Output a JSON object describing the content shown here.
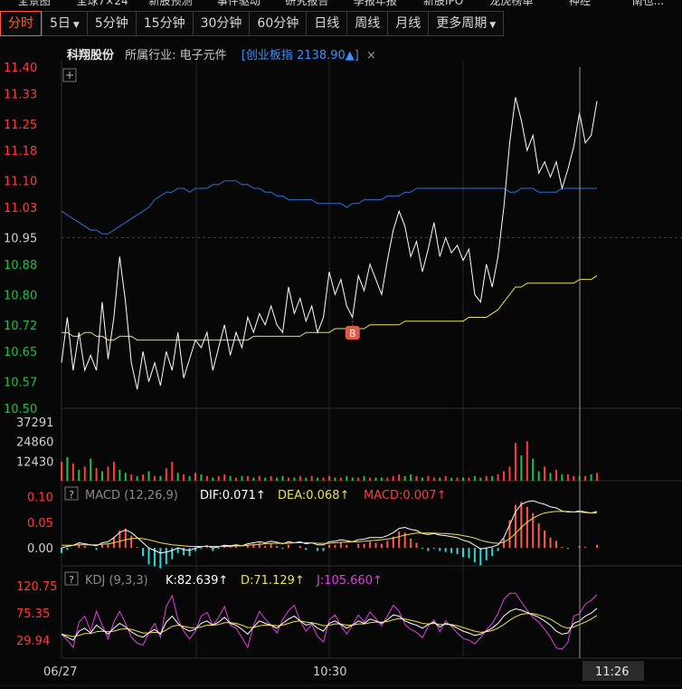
{
  "top_nav": [
    "全景图",
    "全球7×24",
    "新股预测",
    "事件驱动",
    "研究报告",
    "季报年报",
    "新股IPO",
    "龙虎榜单",
    "神经",
    "南也..."
  ],
  "tabs": [
    {
      "label": "分时",
      "active": true
    },
    {
      "label": "5日",
      "dropdown": true
    },
    {
      "label": "5分钟"
    },
    {
      "label": "15分钟"
    },
    {
      "label": "30分钟"
    },
    {
      "label": "60分钟"
    },
    {
      "label": "日线"
    },
    {
      "label": "周线"
    },
    {
      "label": "月线"
    },
    {
      "label": "更多周期",
      "dropdown": true
    }
  ],
  "info": {
    "stock_name": "科翔股份",
    "industry": "所属行业: 电子元件",
    "index": "[创业板指 2138.90▲]",
    "close": "×"
  },
  "price_axis": [
    "11.40",
    "11.33",
    "11.25",
    "11.18",
    "11.10",
    "11.03",
    "10.95",
    "10.88",
    "10.80",
    "10.72",
    "10.65",
    "10.57",
    "10.50"
  ],
  "volume_axis": [
    "37291",
    "24860",
    "12430"
  ],
  "macd": {
    "title": "MACD",
    "params": "(12,26,9)",
    "dif": "DIF:0.071↑",
    "dea": "DEA:0.068↑",
    "macd": "MACD:0.007↑",
    "axis": [
      "0.10",
      "0.05",
      "0.00"
    ]
  },
  "kdj": {
    "title": "KDJ",
    "params": "(9,3,3)",
    "k": "K:82.639↑",
    "d": "D:71.129↑",
    "j": "J:105.660↑",
    "axis": [
      "120.75",
      "75.35",
      "29.94"
    ]
  },
  "time_axis": {
    "start": "06/27",
    "mid": "10:30",
    "cursor": "11:26"
  },
  "marker": {
    "label": "B"
  },
  "colors": {
    "up": "#ff3b3b",
    "down": "#1fbf4a",
    "price": "#ffffff",
    "avg": "#e8e05a",
    "index": "#2f6fd8",
    "macd_pos": "#ff5a4a",
    "macd_neg": "#30d8d8",
    "k": "#ffffff",
    "d": "#f0e040",
    "j": "#e040e0"
  },
  "chart_data": [
    {
      "type": "line",
      "title": "",
      "ylim": [
        10.5,
        11.4
      ],
      "series": [
        {
          "values": [
            10.62,
            10.74,
            10.6,
            10.7,
            10.6,
            10.64,
            10.6,
            10.78,
            10.63,
            10.74,
            10.9,
            10.78,
            10.62,
            10.55,
            10.65,
            10.57,
            10.62,
            10.56,
            10.65,
            10.6,
            10.7,
            10.58,
            10.63,
            10.68,
            10.66,
            10.7,
            10.6,
            10.66,
            10.72,
            10.64,
            10.7,
            10.66,
            10.74,
            10.7,
            10.75,
            10.72,
            10.77,
            10.72,
            10.7,
            10.82,
            10.75,
            10.79,
            10.73,
            10.77,
            10.7,
            10.74,
            10.86,
            10.8,
            10.84,
            10.77,
            10.74,
            10.85,
            10.81,
            10.88,
            10.84,
            10.8,
            10.89,
            10.97,
            11.02,
            10.98,
            10.9,
            10.94,
            10.86,
            10.92,
            10.99,
            10.9,
            10.95,
            10.91,
            10.93,
            10.89,
            10.92,
            10.8,
            10.78,
            10.88,
            10.82,
            10.9,
            11.03,
            11.2,
            11.32,
            11.26,
            11.18,
            11.22,
            11.12,
            11.15,
            11.11,
            11.15,
            11.08,
            11.13,
            11.19,
            11.28,
            11.2,
            11.22,
            11.31
          ]
        },
        {
          "values": [
            10.7,
            10.7,
            10.69,
            10.69,
            10.7,
            10.7,
            10.69,
            10.69,
            10.68,
            10.68,
            10.69,
            10.69,
            10.69,
            10.68,
            10.68,
            10.68,
            10.68,
            10.68,
            10.68,
            10.68,
            10.68,
            10.68,
            10.68,
            10.68,
            10.68,
            10.68,
            10.68,
            10.68,
            10.68,
            10.68,
            10.68,
            10.68,
            10.68,
            10.69,
            10.69,
            10.69,
            10.69,
            10.69,
            10.69,
            10.69,
            10.69,
            10.69,
            10.7,
            10.7,
            10.7,
            10.7,
            10.7,
            10.71,
            10.71,
            10.71,
            10.71,
            10.71,
            10.71,
            10.72,
            10.72,
            10.72,
            10.72,
            10.72,
            10.72,
            10.73,
            10.73,
            10.73,
            10.73,
            10.73,
            10.73,
            10.73,
            10.73,
            10.73,
            10.73,
            10.73,
            10.74,
            10.74,
            10.74,
            10.74,
            10.75,
            10.76,
            10.78,
            10.8,
            10.82,
            10.82,
            10.83,
            10.83,
            10.83,
            10.83,
            10.83,
            10.83,
            10.83,
            10.83,
            10.83,
            10.84,
            10.84,
            10.84,
            10.85
          ]
        },
        {
          "values": [
            11.02,
            11.01,
            11.0,
            10.99,
            10.98,
            10.97,
            10.97,
            10.96,
            10.96,
            10.97,
            10.98,
            10.99,
            11.0,
            11.01,
            11.02,
            11.03,
            11.05,
            11.06,
            11.07,
            11.07,
            11.08,
            11.08,
            11.07,
            11.08,
            11.08,
            11.08,
            11.09,
            11.09,
            11.1,
            11.1,
            11.1,
            11.09,
            11.09,
            11.08,
            11.08,
            11.07,
            11.07,
            11.06,
            11.06,
            11.05,
            11.05,
            11.05,
            11.05,
            11.05,
            11.04,
            11.04,
            11.04,
            11.04,
            11.04,
            11.03,
            11.04,
            11.04,
            11.05,
            11.05,
            11.05,
            11.05,
            11.06,
            11.06,
            11.06,
            11.07,
            11.07,
            11.08,
            11.08,
            11.08,
            11.08,
            11.08,
            11.08,
            11.08,
            11.08,
            11.08,
            11.08,
            11.08,
            11.08,
            11.08,
            11.08,
            11.08,
            11.08,
            11.07,
            11.07,
            11.08,
            11.08,
            11.08,
            11.07,
            11.07,
            11.07,
            11.07,
            11.08,
            11.08,
            11.08,
            11.08,
            11.08,
            11.08,
            11.08
          ]
        }
      ]
    },
    {
      "type": "bar",
      "title": "",
      "ylim": [
        0,
        37291
      ],
      "values": [
        12000,
        15000,
        11000,
        7000,
        9000,
        14000,
        8000,
        6000,
        9000,
        12000,
        7000,
        5000,
        4000,
        3000,
        4000,
        6000,
        3000,
        3000,
        8000,
        12000,
        5000,
        4000,
        3000,
        5000,
        4000,
        3000,
        2000,
        3000,
        4000,
        3000,
        2000,
        3000,
        3000,
        2000,
        3000,
        2000,
        3000,
        2000,
        3000,
        2000,
        2000,
        3000,
        2000,
        3000,
        2000,
        2000,
        3000,
        2000,
        2000,
        3000,
        2000,
        2000,
        3000,
        2000,
        2000,
        2000,
        2000,
        3000,
        4000,
        3000,
        4000,
        3000,
        2000,
        3000,
        2000,
        2000,
        3000,
        2000,
        2000,
        2000,
        2000,
        3000,
        2000,
        3000,
        3000,
        4000,
        6000,
        9000,
        24000,
        16000,
        25000,
        14000,
        6000,
        9000,
        5000,
        7000,
        4000,
        4000,
        3000,
        3000,
        3000,
        4000,
        5000
      ],
      "up": [
        1,
        0,
        1,
        0,
        1,
        0,
        1,
        0,
        1,
        1,
        0,
        0,
        1,
        0,
        1,
        0,
        1,
        0,
        1,
        1,
        0,
        1,
        0,
        1,
        0,
        1,
        0,
        1,
        1,
        0,
        1,
        0,
        1,
        0,
        1,
        0,
        1,
        0,
        0,
        1,
        0,
        1,
        0,
        1,
        0,
        1,
        1,
        0,
        1,
        0,
        0,
        1,
        0,
        1,
        0,
        0,
        1,
        1,
        1,
        0,
        0,
        1,
        0,
        1,
        1,
        0,
        1,
        0,
        1,
        0,
        1,
        0,
        0,
        1,
        0,
        1,
        1,
        1,
        1,
        0,
        1,
        0,
        0,
        1,
        0,
        1,
        0,
        1,
        1,
        0,
        1,
        0,
        1
      ]
    },
    {
      "type": "line",
      "title": "MACD",
      "ylim": [
        -0.035,
        0.115
      ],
      "series": [
        {
          "name": "DIF",
          "values": [
            0.0,
            0.003,
            0.005,
            0.01,
            0.008,
            0.006,
            0.004,
            0.01,
            0.012,
            0.02,
            0.03,
            0.035,
            0.03,
            0.02,
            0.01,
            0.0,
            -0.005,
            -0.01,
            -0.008,
            -0.005,
            0.0,
            -0.003,
            -0.005,
            0.0,
            0.002,
            0.004,
            0.0,
            0.002,
            0.005,
            0.004,
            0.006,
            0.004,
            0.008,
            0.01,
            0.012,
            0.01,
            0.013,
            0.011,
            0.008,
            0.012,
            0.01,
            0.012,
            0.008,
            0.01,
            0.006,
            0.006,
            0.012,
            0.013,
            0.016,
            0.014,
            0.012,
            0.016,
            0.017,
            0.02,
            0.02,
            0.02,
            0.024,
            0.03,
            0.038,
            0.04,
            0.036,
            0.034,
            0.028,
            0.026,
            0.028,
            0.025,
            0.024,
            0.022,
            0.02,
            0.015,
            0.012,
            0.005,
            -0.002,
            0.0,
            0.002,
            0.006,
            0.02,
            0.045,
            0.07,
            0.085,
            0.09,
            0.092,
            0.088,
            0.085,
            0.08,
            0.078,
            0.072,
            0.07,
            0.07,
            0.072,
            0.07,
            0.068,
            0.071
          ]
        },
        {
          "name": "DEA",
          "values": [
            0.005,
            0.005,
            0.005,
            0.006,
            0.006,
            0.006,
            0.006,
            0.007,
            0.008,
            0.01,
            0.013,
            0.016,
            0.018,
            0.019,
            0.018,
            0.016,
            0.013,
            0.01,
            0.008,
            0.006,
            0.005,
            0.004,
            0.003,
            0.003,
            0.003,
            0.003,
            0.003,
            0.003,
            0.003,
            0.003,
            0.004,
            0.004,
            0.005,
            0.006,
            0.007,
            0.008,
            0.009,
            0.009,
            0.009,
            0.009,
            0.01,
            0.01,
            0.01,
            0.01,
            0.009,
            0.009,
            0.009,
            0.01,
            0.011,
            0.011,
            0.012,
            0.012,
            0.013,
            0.014,
            0.015,
            0.016,
            0.017,
            0.019,
            0.022,
            0.025,
            0.027,
            0.029,
            0.029,
            0.029,
            0.029,
            0.028,
            0.028,
            0.027,
            0.026,
            0.024,
            0.022,
            0.019,
            0.015,
            0.012,
            0.01,
            0.009,
            0.011,
            0.018,
            0.028,
            0.04,
            0.05,
            0.058,
            0.064,
            0.068,
            0.07,
            0.071,
            0.071,
            0.071,
            0.07,
            0.07,
            0.069,
            0.068,
            0.068
          ]
        }
      ]
    },
    {
      "type": "line",
      "title": "KDJ",
      "ylim": [
        0,
        140
      ],
      "series": [
        {
          "name": "K",
          "values": [
            40,
            35,
            30,
            45,
            50,
            42,
            55,
            48,
            40,
            50,
            58,
            52,
            44,
            38,
            35,
            42,
            48,
            40,
            60,
            70,
            58,
            50,
            45,
            48,
            58,
            62,
            55,
            60,
            68,
            58,
            55,
            48,
            40,
            52,
            62,
            58,
            55,
            50,
            58,
            65,
            70,
            62,
            55,
            58,
            50,
            45,
            58,
            62,
            56,
            50,
            55,
            62,
            58,
            65,
            62,
            58,
            64,
            72,
            70,
            62,
            58,
            55,
            50,
            56,
            60,
            52,
            58,
            55,
            50,
            45,
            42,
            38,
            40,
            45,
            50,
            58,
            70,
            78,
            82,
            80,
            76,
            72,
            68,
            62,
            55,
            45,
            40,
            42,
            58,
            62,
            70,
            75,
            83
          ]
        },
        {
          "name": "D",
          "values": [
            40,
            38,
            36,
            38,
            41,
            41,
            44,
            45,
            44,
            45,
            48,
            49,
            48,
            45,
            42,
            42,
            43,
            42,
            47,
            53,
            55,
            53,
            51,
            50,
            52,
            55,
            55,
            56,
            59,
            59,
            58,
            55,
            51,
            51,
            54,
            55,
            55,
            54,
            55,
            58,
            61,
            62,
            60,
            59,
            57,
            54,
            55,
            57,
            57,
            55,
            55,
            57,
            57,
            59,
            60,
            60,
            61,
            64,
            66,
            65,
            63,
            61,
            58,
            57,
            58,
            56,
            56,
            56,
            54,
            51,
            48,
            45,
            43,
            44,
            46,
            50,
            56,
            63,
            69,
            73,
            74,
            74,
            72,
            69,
            65,
            59,
            53,
            50,
            52,
            56,
            60,
            65,
            71
          ]
        },
        {
          "name": "J",
          "values": [
            40,
            30,
            18,
            60,
            70,
            45,
            78,
            55,
            32,
            60,
            78,
            58,
            35,
            25,
            22,
            42,
            58,
            35,
            86,
            104,
            65,
            45,
            32,
            45,
            70,
            76,
            55,
            68,
            86,
            55,
            50,
            34,
            18,
            55,
            78,
            65,
            55,
            42,
            64,
            79,
            88,
            62,
            45,
            56,
            36,
            27,
            64,
            72,
            54,
            40,
            55,
            72,
            60,
            77,
            66,
            54,
            70,
            88,
            78,
            56,
            48,
            43,
            34,
            53,
            64,
            44,
            62,
            53,
            42,
            33,
            30,
            24,
            34,
            47,
            58,
            74,
            98,
            108,
            108,
            94,
            80,
            68,
            60,
            48,
            35,
            17,
            15,
            26,
            70,
            74,
            90,
            96,
            106
          ]
        }
      ]
    }
  ]
}
